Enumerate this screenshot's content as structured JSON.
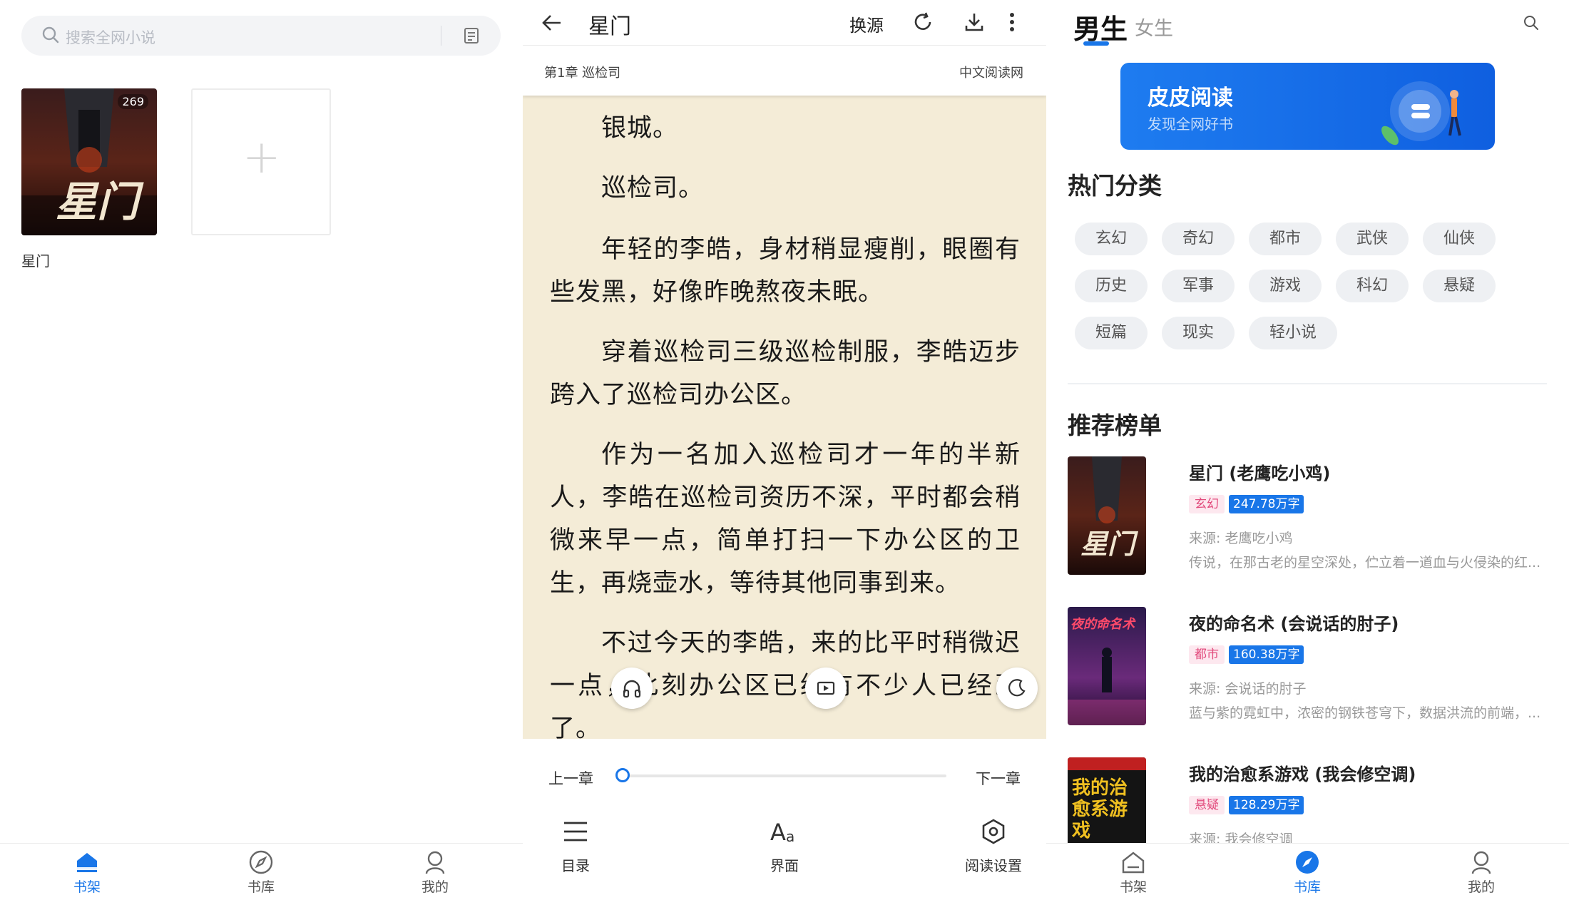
{
  "shelf": {
    "search_placeholder": "搜索全网小说",
    "book": {
      "title": "星门",
      "badge": "269",
      "cover_text": "星门"
    },
    "add_symbol": "+",
    "tabs": [
      {
        "label": "书架",
        "icon": "home-icon",
        "active": true
      },
      {
        "label": "书库",
        "icon": "compass-icon",
        "active": false
      },
      {
        "label": "我的",
        "icon": "user-icon",
        "active": false
      }
    ]
  },
  "reader": {
    "title": "星门",
    "change_source": "换源",
    "chapter": "第1章 巡检司",
    "site": "中文阅读网",
    "paragraphs": [
      "银城。",
      "巡检司。",
      "年轻的李皓，身材稍显瘦削，眼圈有些发黑，好像昨晚熬夜未眠。",
      "穿着巡检司三级巡检制服，李皓迈步跨入了巡检司办公区。",
      "作为一名加入巡检司才一年的半新人，李皓在巡检司资历不深，平时都会稍微来早一点，简单打扫一下办公区的卫生，再烧壶水，等待其他同事到来。",
      "不过今天的李皓，来的比平时稍微迟一点，此刻办公区已经有不少人已经到了。"
    ],
    "prev_chapter": "上一章",
    "next_chapter": "下一章",
    "progress": 0,
    "menu": [
      {
        "label": "目录",
        "icon": "list-icon"
      },
      {
        "label": "界面",
        "icon": "font-icon"
      },
      {
        "label": "阅读设置",
        "icon": "settings-icon"
      }
    ],
    "accent": "#1976e8",
    "paper_color": "#f4ecd7"
  },
  "library": {
    "tab_male": "男生",
    "tab_female": "女生",
    "banner_title": "皮皮阅读",
    "banner_subtitle": "发现全网好书",
    "categories_title": "热门分类",
    "categories": [
      "玄幻",
      "奇幻",
      "都市",
      "武侠",
      "仙侠",
      "历史",
      "军事",
      "游戏",
      "科幻",
      "悬疑",
      "短篇",
      "现实",
      "轻小说"
    ],
    "rank_title": "推荐榜单",
    "books": [
      {
        "title": "星门 (老鹰吃小鸡)",
        "tag": "玄幻",
        "words": "247.78万字",
        "source": "来源: 老鹰吃小鸡",
        "desc": "传说，在那古老的星空深处，伫立着一道血与火侵染的红...",
        "cover_text": "星门"
      },
      {
        "title": "夜的命名术 (会说话的肘子)",
        "tag": "都市",
        "words": "160.38万字",
        "source": "来源: 会说话的肘子",
        "desc": "蓝与紫的霓虹中，浓密的钢铁苍穹下，数据洪流的前端，...",
        "cover_text": "夜的命名术"
      },
      {
        "title": "我的治愈系游戏 (我会修空调)",
        "tag": "悬疑",
        "words": "128.29万字",
        "source": "来源: 我会修空调",
        "desc": "",
        "cover_text": "我的治愈系游戏"
      }
    ],
    "tabs": [
      {
        "label": "书架",
        "icon": "home-icon",
        "active": false
      },
      {
        "label": "书库",
        "icon": "compass-icon",
        "active": true
      },
      {
        "label": "我的",
        "icon": "user-icon",
        "active": false
      }
    ]
  }
}
